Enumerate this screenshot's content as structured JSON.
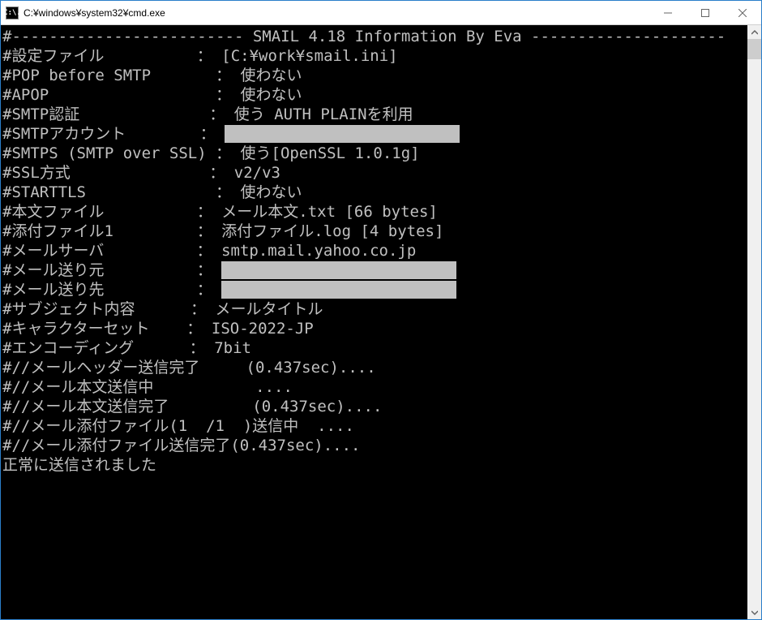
{
  "window": {
    "title": "C:¥windows¥system32¥cmd.exe",
    "icon_text": "C:\\."
  },
  "console": {
    "header": "#------------------------- SMAIL 4.18 Information By Eva ---------------------",
    "rows": [
      {
        "label": "#設定ファイル",
        "sep": "          ： ",
        "value": "[C:¥work¥smail.ini]"
      },
      {
        "label": "#POP before SMTP",
        "sep": "       ： ",
        "value": "使わない"
      },
      {
        "label": "#APOP",
        "sep": "                  ： ",
        "value": "使わない"
      },
      {
        "label": "#SMTP認証",
        "sep": "              ： ",
        "value": "使う AUTH PLAINを利用"
      },
      {
        "label": "#SMTPアカウント",
        "sep": "        ： ",
        "value": "",
        "redact": 1
      },
      {
        "label": "#SMTPS (SMTP over SSL)",
        "sep": " ： ",
        "value": "使う[OpenSSL 1.0.1g]"
      },
      {
        "label": "#SSL方式",
        "sep": "               ： ",
        "value": "v2/v3"
      },
      {
        "label": "#STARTTLS",
        "sep": "              ： ",
        "value": "使わない"
      },
      {
        "label": "#本文ファイル",
        "sep": "          ： ",
        "value": "メール本文.txt [66 bytes]"
      },
      {
        "label": "#添付ファイル1",
        "sep": "         ： ",
        "value": "添付ファイル.log [4 bytes]"
      },
      {
        "label": "#メールサーバ",
        "sep": "          ： ",
        "value": "smtp.mail.yahoo.co.jp"
      },
      {
        "label": "#メール送り元",
        "sep": "          ： ",
        "value": "",
        "redact": 2
      },
      {
        "label": "#メール送り先",
        "sep": "          ： ",
        "value": "",
        "redact": 2
      },
      {
        "label": "#サブジェクト内容",
        "sep": "      ： ",
        "value": "メールタイトル"
      },
      {
        "label": "#キャラクターセット",
        "sep": "    ： ",
        "value": "ISO-2022-JP"
      },
      {
        "label": "#エンコーディング",
        "sep": "      ： ",
        "value": "7bit"
      }
    ],
    "progress": [
      "#//メールヘッダー送信完了     (0.437sec)....",
      "#//メール本文送信中           ....",
      "#//メール本文送信完了         (0.437sec)....",
      "#//メール添付ファイル(1  /1  )送信中  ....",
      "#//メール添付ファイル送信完了(0.437sec)...."
    ],
    "result": "正常に送信されました"
  }
}
